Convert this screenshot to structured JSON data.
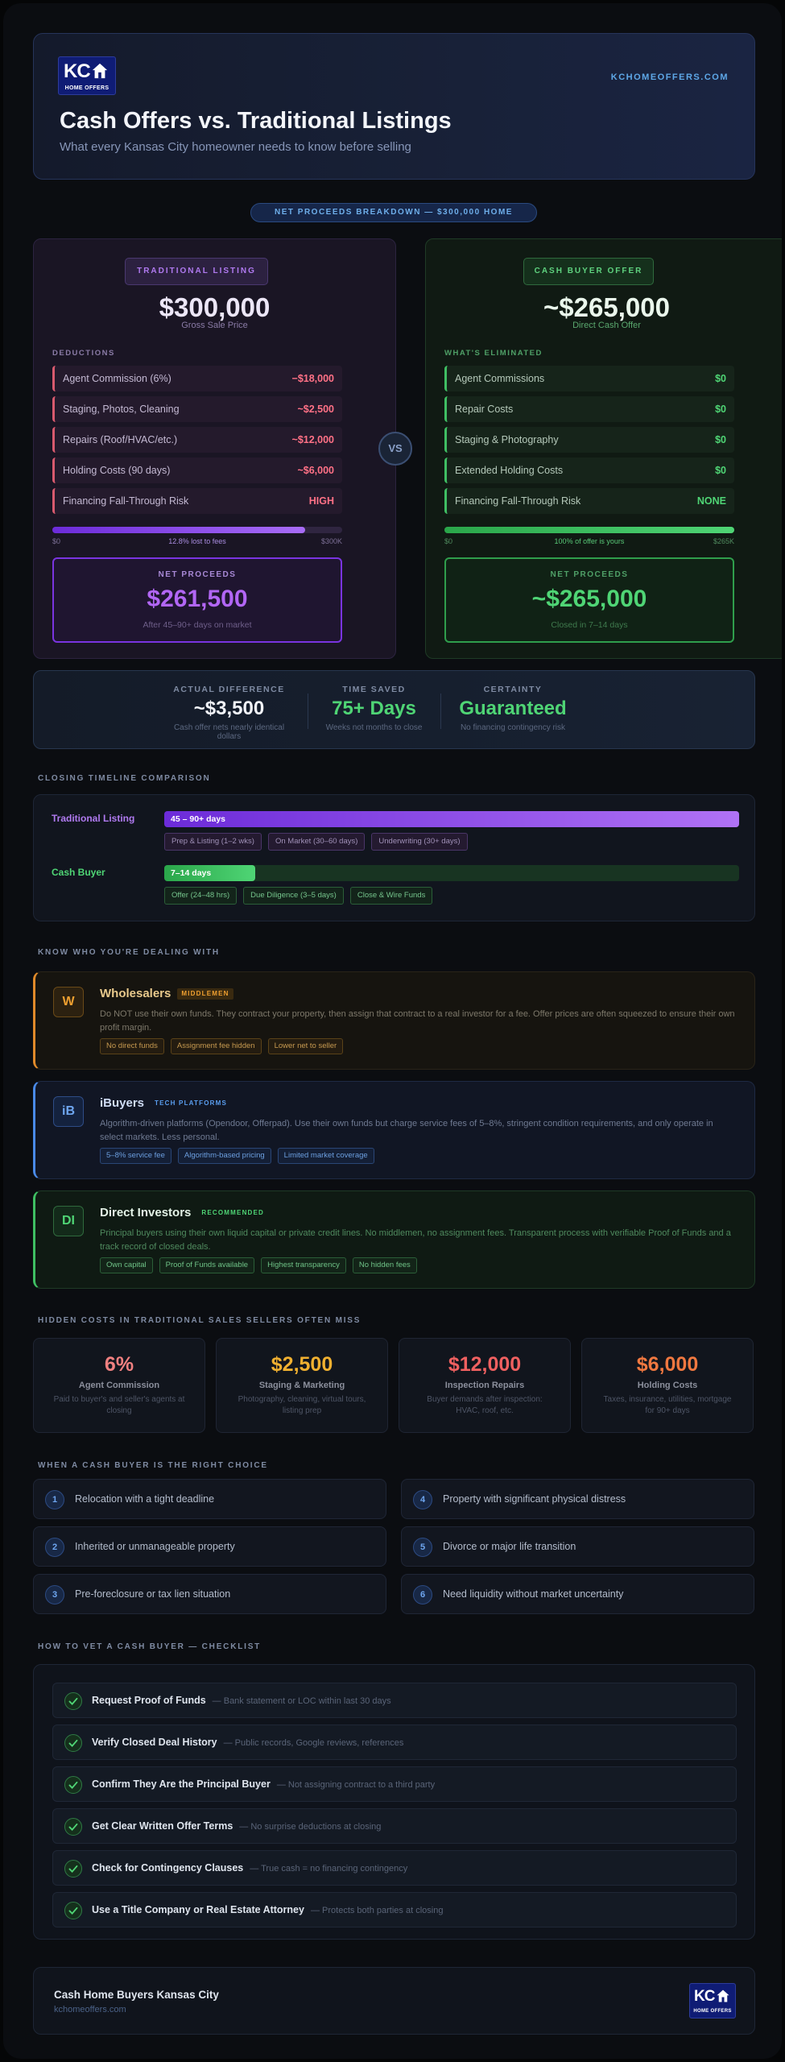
{
  "brand": {
    "logo_text": "KC",
    "logo_sub": "HOME OFFERS",
    "site": "KCHOMEOFFERS.COM",
    "icon": "house-icon"
  },
  "header": {
    "title": "Cash Offers vs. Traditional Listings",
    "subtitle": "What every Kansas City homeowner needs to know before selling"
  },
  "breakdown_pill": "NET PROCEEDS BREAKDOWN — $300,000 HOME",
  "traditional": {
    "tag": "TRADITIONAL LISTING",
    "price": "$300,000",
    "price_sub": "Gross Sale Price",
    "section": "DEDUCTIONS",
    "rows": [
      {
        "label": "Agent Commission (6%)",
        "value": "−$18,000"
      },
      {
        "label": "Staging, Photos, Cleaning",
        "value": "~$2,500"
      },
      {
        "label": "Repairs (Roof/HVAC/etc.)",
        "value": "~$12,000"
      },
      {
        "label": "Holding Costs (90 days)",
        "value": "~$6,000"
      },
      {
        "label": "Financing Fall-Through Risk",
        "value": "HIGH"
      }
    ],
    "bar": {
      "fill_fraction": 0.873,
      "left": "$0",
      "center": "12.8% lost to fees",
      "right": "$300K"
    },
    "net_label": "NET PROCEEDS",
    "net_value": "$261,500",
    "net_sub": "After 45–90+ days on market"
  },
  "vs_label": "VS",
  "cash": {
    "tag": "CASH BUYER OFFER",
    "price": "~$265,000",
    "price_sub": "Direct Cash Offer",
    "section": "WHAT'S ELIMINATED",
    "rows": [
      {
        "label": "Agent Commissions",
        "value": "$0"
      },
      {
        "label": "Repair Costs",
        "value": "$0"
      },
      {
        "label": "Staging & Photography",
        "value": "$0"
      },
      {
        "label": "Extended Holding Costs",
        "value": "$0"
      },
      {
        "label": "Financing Fall-Through Risk",
        "value": "NONE"
      }
    ],
    "bar": {
      "fill_fraction": 1.0,
      "left": "$0",
      "center": "100% of offer is yours",
      "right": "$265K"
    },
    "net_label": "NET PROCEEDS",
    "net_value": "~$265,000",
    "net_sub": "Closed in 7–14 days"
  },
  "stats": [
    {
      "label": "ACTUAL DIFFERENCE",
      "value": "~$3,500",
      "sub": "Cash offer nets nearly identical dollars"
    },
    {
      "label": "TIME SAVED",
      "value": "75+ Days",
      "sub": "Weeks not months to close"
    },
    {
      "label": "CERTAINTY",
      "value": "Guaranteed",
      "sub": "No financing contingency risk"
    }
  ],
  "timeline": {
    "heading": "CLOSING TIMELINE COMPARISON",
    "rows": [
      {
        "label": "Traditional Listing",
        "bar_text": "45 – 90+ days",
        "fill_fraction": 1.0,
        "chips": [
          "Prep & Listing (1–2 wks)",
          "On Market (30–60 days)",
          "Underwriting (30+ days)"
        ]
      },
      {
        "label": "Cash Buyer",
        "bar_text": "7–14 days",
        "fill_fraction": 0.158,
        "chips": [
          "Offer (24–48 hrs)",
          "Due Diligence (3–5 days)",
          "Close & Wire Funds"
        ]
      }
    ]
  },
  "know": {
    "heading": "KNOW WHO YOU'RE DEALING WITH",
    "cards": [
      {
        "initials": "W",
        "title": "Wholesalers",
        "badge": "MIDDLEMEN",
        "desc": "Do NOT use their own funds. They contract your property, then assign that contract to a real investor for a fee. Offer prices are often squeezed to ensure their own profit margin.",
        "chips": [
          "No direct funds",
          "Assignment fee hidden",
          "Lower net to seller"
        ]
      },
      {
        "initials": "iB",
        "title": "iBuyers",
        "badge": "TECH PLATFORMS",
        "desc": "Algorithm-driven platforms (Opendoor, Offerpad). Use their own funds but charge service fees of 5–8%, stringent condition requirements, and only operate in select markets. Less personal.",
        "chips": [
          "5–8% service fee",
          "Algorithm-based pricing",
          "Limited market coverage"
        ]
      },
      {
        "initials": "DI",
        "title": "Direct Investors",
        "badge": "RECOMMENDED",
        "desc": "Principal buyers using their own liquid capital or private credit lines. No middlemen, no assignment fees. Transparent process with verifiable Proof of Funds and a track record of closed deals.",
        "chips": [
          "Own capital",
          "Proof of Funds available",
          "Highest transparency",
          "No hidden fees"
        ]
      }
    ]
  },
  "hidden": {
    "heading": "HIDDEN COSTS IN TRADITIONAL SALES SELLERS OFTEN MISS",
    "items": [
      {
        "value": "6%",
        "title": "Agent Commission",
        "desc": "Paid to buyer's and seller's agents at closing",
        "color": "#f08080"
      },
      {
        "value": "$2,500",
        "title": "Staging & Marketing",
        "desc": "Photography, cleaning, virtual tours, listing prep",
        "color": "#f0b030"
      },
      {
        "value": "$12,000",
        "title": "Inspection Repairs",
        "desc": "Buyer demands after inspection: HVAC, roof, etc.",
        "color": "#f06060"
      },
      {
        "value": "$6,000",
        "title": "Holding Costs",
        "desc": "Taxes, insurance, utilities, mortgage for 90+ days",
        "color": "#f07840"
      }
    ]
  },
  "choices": {
    "heading": "WHEN A CASH BUYER IS THE RIGHT CHOICE",
    "items": [
      {
        "num": "1",
        "text": "Relocation with a tight deadline"
      },
      {
        "num": "4",
        "text": "Property with significant physical distress"
      },
      {
        "num": "2",
        "text": "Inherited or unmanageable property"
      },
      {
        "num": "5",
        "text": "Divorce or major life transition"
      },
      {
        "num": "3",
        "text": "Pre-foreclosure or tax lien situation"
      },
      {
        "num": "6",
        "text": "Need liquidity without market uncertainty"
      }
    ]
  },
  "checklist": {
    "heading": "HOW TO VET A CASH BUYER — CHECKLIST",
    "items": [
      {
        "title": "Request Proof of Funds",
        "desc": "— Bank statement or LOC within last 30 days"
      },
      {
        "title": "Verify Closed Deal History",
        "desc": "— Public records, Google reviews, references"
      },
      {
        "title": "Confirm They Are the Principal Buyer",
        "desc": "— Not assigning contract to a third party"
      },
      {
        "title": "Get Clear Written Offer Terms",
        "desc": "— No surprise deductions at closing"
      },
      {
        "title": "Check for Contingency Clauses",
        "desc": "— True cash = no financing contingency"
      },
      {
        "title": "Use a Title Company or Real Estate Attorney",
        "desc": "— Protects both parties at closing"
      }
    ]
  },
  "footer": {
    "name": "Cash Home Buyers Kansas City",
    "url": "kchomeoffers.com"
  }
}
